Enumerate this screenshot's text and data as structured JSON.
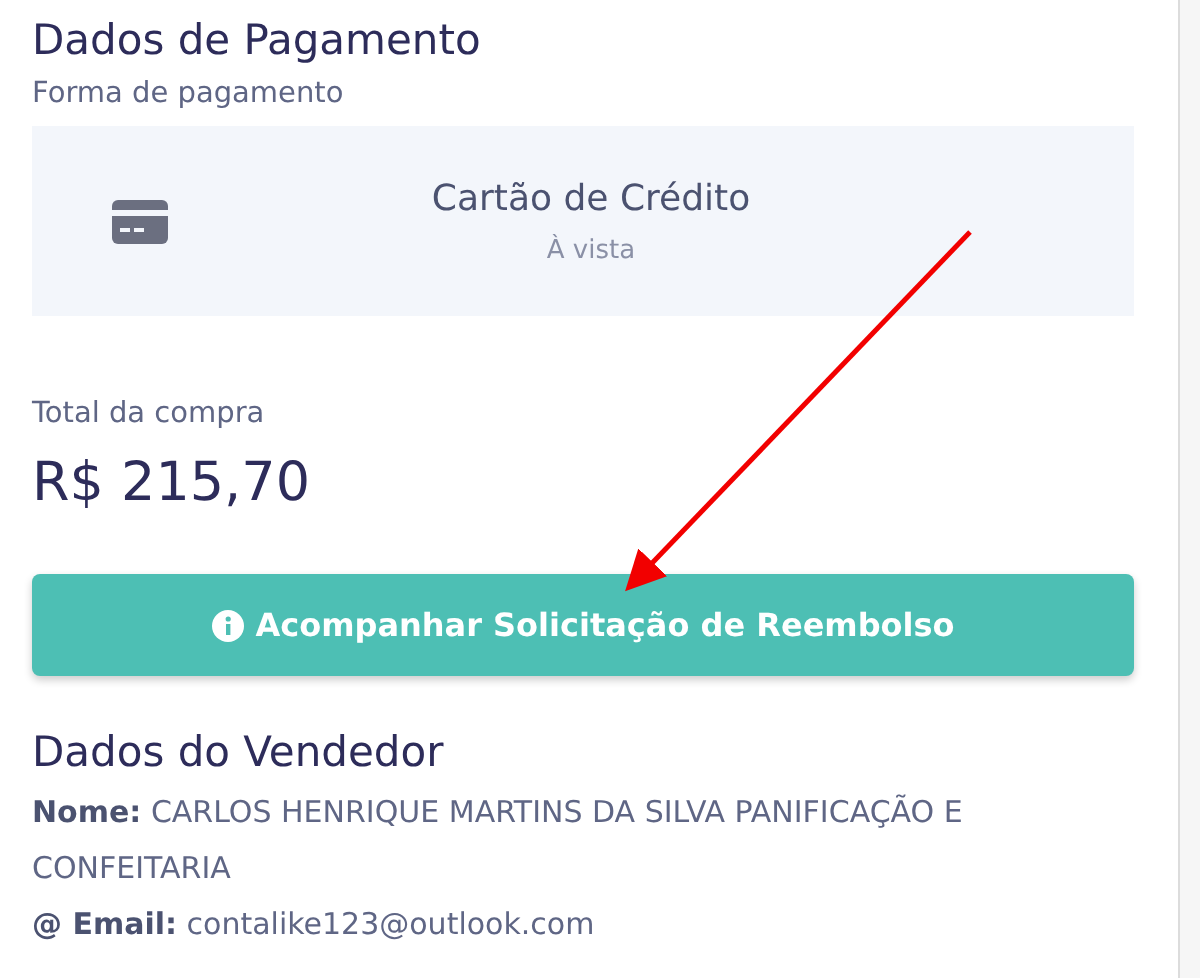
{
  "payment": {
    "title": "Dados de Pagamento",
    "method_label": "Forma de pagamento",
    "method": {
      "name": "Cartão de Crédito",
      "terms": "À vista"
    },
    "total_label": "Total da compra",
    "total": "R$ 215,70",
    "refund_button": "Acompanhar Solicitação de Reembolso"
  },
  "seller": {
    "title": "Dados do Vendedor",
    "fields": [
      {
        "label": "Nome:",
        "value": "CARLOS HENRIQUE MARTINS DA SILVA PANIFICAÇÃO E CONFEITARIA"
      },
      {
        "label": "@ Email:",
        "value": "contalike123@outlook.com"
      }
    ]
  }
}
